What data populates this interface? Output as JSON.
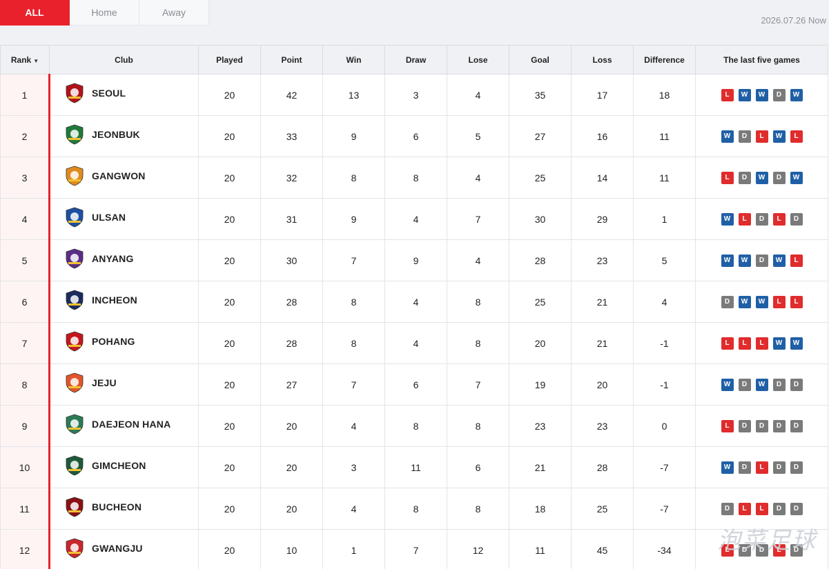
{
  "tabs": [
    {
      "label": "ALL",
      "active": true
    },
    {
      "label": "Home",
      "active": false
    },
    {
      "label": "Away",
      "active": false
    }
  ],
  "updated": "2026.07.26 Now",
  "columns": [
    "Rank",
    "Club",
    "Played",
    "Point",
    "Win",
    "Draw",
    "Lose",
    "Goal",
    "Loss",
    "Difference",
    "The last five games"
  ],
  "colors": {
    "accent": "#e8212c",
    "win": "#1f5fa6",
    "draw": "#7a7a7a",
    "loss": "#e02c2c"
  },
  "rows": [
    {
      "rank": "1",
      "club": "SEOUL",
      "crest": "seoul-crest-icon",
      "crest_color": "#b3121a",
      "played": "20",
      "point": "42",
      "win": "13",
      "draw": "3",
      "lose": "4",
      "goal": "35",
      "loss": "17",
      "diff": "18",
      "last5": [
        "L",
        "W",
        "W",
        "D",
        "W"
      ]
    },
    {
      "rank": "2",
      "club": "JEONBUK",
      "crest": "jeonbuk-crest-icon",
      "crest_color": "#1f7a3a",
      "played": "20",
      "point": "33",
      "win": "9",
      "draw": "6",
      "lose": "5",
      "goal": "27",
      "loss": "16",
      "diff": "11",
      "last5": [
        "W",
        "D",
        "L",
        "W",
        "L"
      ]
    },
    {
      "rank": "3",
      "club": "GANGWON",
      "crest": "gangwon-crest-icon",
      "crest_color": "#e08a1e",
      "played": "20",
      "point": "32",
      "win": "8",
      "draw": "8",
      "lose": "4",
      "goal": "25",
      "loss": "14",
      "diff": "11",
      "last5": [
        "L",
        "D",
        "W",
        "D",
        "W"
      ]
    },
    {
      "rank": "4",
      "club": "ULSAN",
      "crest": "ulsan-crest-icon",
      "crest_color": "#1d4fa3",
      "played": "20",
      "point": "31",
      "win": "9",
      "draw": "4",
      "lose": "7",
      "goal": "30",
      "loss": "29",
      "diff": "1",
      "last5": [
        "W",
        "L",
        "D",
        "L",
        "D"
      ]
    },
    {
      "rank": "5",
      "club": "ANYANG",
      "crest": "anyang-crest-icon",
      "crest_color": "#5b2d86",
      "played": "20",
      "point": "30",
      "win": "7",
      "draw": "9",
      "lose": "4",
      "goal": "28",
      "loss": "23",
      "diff": "5",
      "last5": [
        "W",
        "W",
        "D",
        "W",
        "L"
      ]
    },
    {
      "rank": "6",
      "club": "INCHEON",
      "crest": "incheon-crest-icon",
      "crest_color": "#1c2b5e",
      "played": "20",
      "point": "28",
      "win": "8",
      "draw": "4",
      "lose": "8",
      "goal": "25",
      "loss": "21",
      "diff": "4",
      "last5": [
        "D",
        "W",
        "W",
        "L",
        "L"
      ]
    },
    {
      "rank": "7",
      "club": "POHANG",
      "crest": "pohang-crest-icon",
      "crest_color": "#c4161c",
      "played": "20",
      "point": "28",
      "win": "8",
      "draw": "4",
      "lose": "8",
      "goal": "20",
      "loss": "21",
      "diff": "-1",
      "last5": [
        "L",
        "L",
        "L",
        "W",
        "W"
      ]
    },
    {
      "rank": "8",
      "club": "JEJU",
      "crest": "jeju-crest-icon",
      "crest_color": "#e0552a",
      "played": "20",
      "point": "27",
      "win": "7",
      "draw": "6",
      "lose": "7",
      "goal": "19",
      "loss": "20",
      "diff": "-1",
      "last5": [
        "W",
        "D",
        "W",
        "D",
        "D"
      ]
    },
    {
      "rank": "9",
      "club": "DAEJEON HANA",
      "crest": "daejeon-crest-icon",
      "crest_color": "#2c7a55",
      "played": "20",
      "point": "20",
      "win": "4",
      "draw": "8",
      "lose": "8",
      "goal": "23",
      "loss": "23",
      "diff": "0",
      "last5": [
        "L",
        "D",
        "D",
        "D",
        "D"
      ]
    },
    {
      "rank": "10",
      "club": "GIMCHEON",
      "crest": "gimcheon-crest-icon",
      "crest_color": "#1e5a3a",
      "played": "20",
      "point": "20",
      "win": "3",
      "draw": "11",
      "lose": "6",
      "goal": "21",
      "loss": "28",
      "diff": "-7",
      "last5": [
        "W",
        "D",
        "L",
        "D",
        "D"
      ]
    },
    {
      "rank": "11",
      "club": "BUCHEON",
      "crest": "bucheon-crest-icon",
      "crest_color": "#8a1014",
      "played": "20",
      "point": "20",
      "win": "4",
      "draw": "8",
      "lose": "8",
      "goal": "18",
      "loss": "25",
      "diff": "-7",
      "last5": [
        "D",
        "L",
        "L",
        "D",
        "D"
      ]
    },
    {
      "rank": "12",
      "club": "GWANGJU",
      "crest": "gwangju-crest-icon",
      "crest_color": "#c9262b",
      "played": "20",
      "point": "10",
      "win": "1",
      "draw": "7",
      "lose": "12",
      "goal": "11",
      "loss": "45",
      "diff": "-34",
      "last5": [
        "L",
        "D",
        "D",
        "L",
        "D"
      ]
    }
  ],
  "watermark": "泡菜足球"
}
